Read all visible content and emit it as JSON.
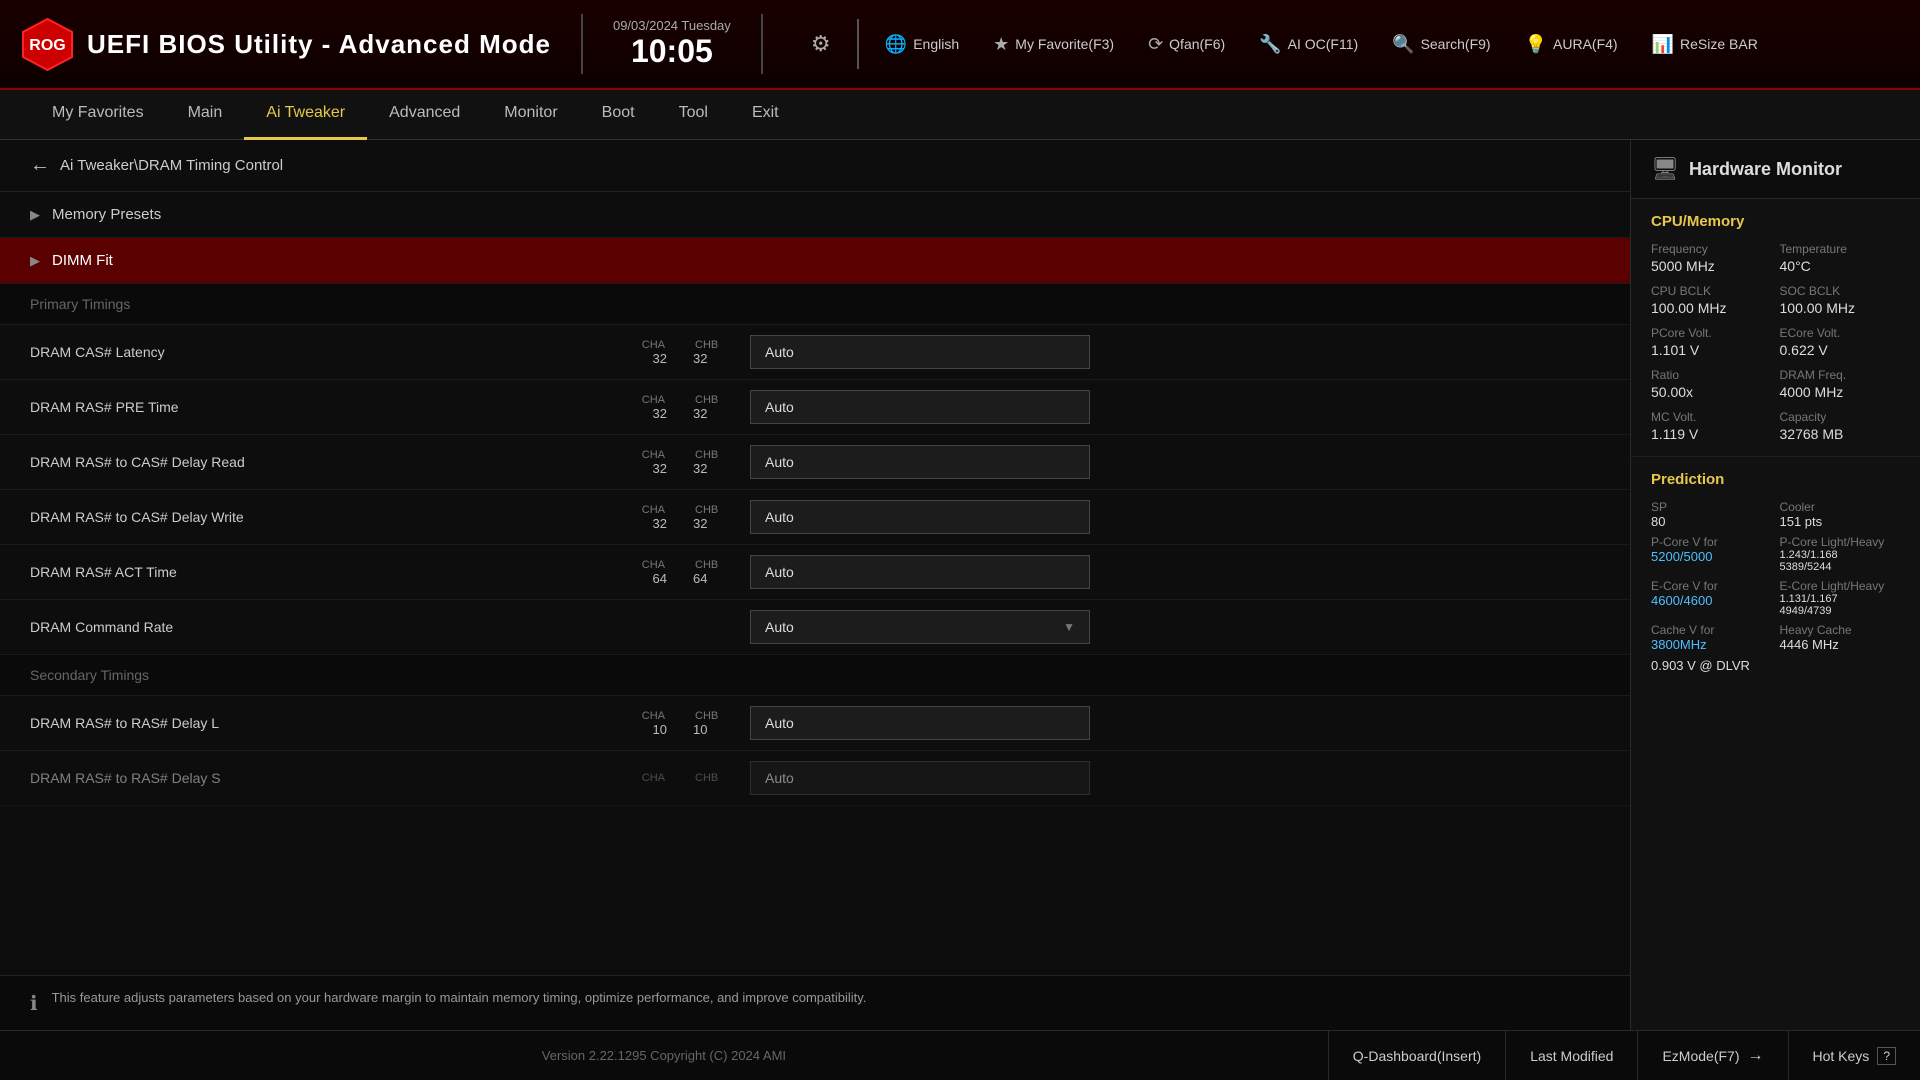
{
  "header": {
    "logo_alt": "ROG Logo",
    "title": "UEFI BIOS Utility - Advanced Mode",
    "date": "09/03/2024 Tuesday",
    "time": "10:05",
    "gear_icon": "⚙",
    "tools": [
      {
        "icon": "🌐",
        "label": "English",
        "key": ""
      },
      {
        "icon": "★",
        "label": "My Favorite(F3)",
        "key": "F3"
      },
      {
        "icon": "⟳",
        "label": "Qfan(F6)",
        "key": "F6"
      },
      {
        "icon": "🔧",
        "label": "AI OC(F11)",
        "key": "F11"
      },
      {
        "icon": "🔍",
        "label": "Search(F9)",
        "key": "F9"
      },
      {
        "icon": "💡",
        "label": "AURA(F4)",
        "key": "F4"
      },
      {
        "icon": "📊",
        "label": "ReSize BAR",
        "key": ""
      }
    ]
  },
  "nav": {
    "items": [
      {
        "label": "My Favorites",
        "active": false
      },
      {
        "label": "Main",
        "active": false
      },
      {
        "label": "Ai Tweaker",
        "active": true
      },
      {
        "label": "Advanced",
        "active": false
      },
      {
        "label": "Monitor",
        "active": false
      },
      {
        "label": "Boot",
        "active": false
      },
      {
        "label": "Tool",
        "active": false
      },
      {
        "label": "Exit",
        "active": false
      }
    ]
  },
  "breadcrumb": {
    "back_icon": "←",
    "path": "Ai Tweaker\\DRAM Timing Control"
  },
  "settings": {
    "sections": [
      {
        "type": "expandable",
        "label": "Memory Presets",
        "arrow": "▶",
        "highlighted": false
      },
      {
        "type": "expandable",
        "label": "DIMM Fit",
        "arrow": "▶",
        "highlighted": true
      }
    ],
    "primary_timings_header": "Primary Timings",
    "primary_timing_rows": [
      {
        "label": "DRAM CAS# Latency",
        "cha_label": "CHA",
        "chb_label": "CHB",
        "cha_val": "32",
        "chb_val": "32",
        "value": "Auto"
      },
      {
        "label": "DRAM RAS# PRE Time",
        "cha_label": "CHA",
        "chb_label": "CHB",
        "cha_val": "32",
        "chb_val": "32",
        "value": "Auto"
      },
      {
        "label": "DRAM RAS# to CAS# Delay Read",
        "cha_label": "CHA",
        "chb_label": "CHB",
        "cha_val": "32",
        "chb_val": "32",
        "value": "Auto"
      },
      {
        "label": "DRAM RAS# to CAS# Delay Write",
        "cha_label": "CHA",
        "chb_label": "CHB",
        "cha_val": "32",
        "chb_val": "32",
        "value": "Auto"
      },
      {
        "label": "DRAM RAS# ACT Time",
        "cha_label": "CHA",
        "chb_label": "CHB",
        "cha_val": "64",
        "chb_val": "64",
        "value": "Auto"
      },
      {
        "label": "DRAM Command Rate",
        "cha_label": "",
        "chb_label": "",
        "cha_val": "",
        "chb_val": "",
        "value": "Auto",
        "is_dropdown": true
      }
    ],
    "secondary_timings_header": "Secondary Timings",
    "secondary_timing_rows": [
      {
        "label": "DRAM RAS# to RAS# Delay L",
        "cha_label": "CHA",
        "chb_label": "CHB",
        "cha_val": "10",
        "chb_val": "10",
        "value": "Auto"
      },
      {
        "label": "DRAM RAS# to RAS# Delay S",
        "cha_label": "CHA",
        "chb_label": "CHB",
        "cha_val": "",
        "chb_val": "",
        "value": "Auto"
      }
    ],
    "info_text": "This feature adjusts parameters based on your hardware margin to maintain memory timing, optimize performance, and improve compatibility."
  },
  "hw_monitor": {
    "title": "Hardware Monitor",
    "monitor_icon": "🖥",
    "cpu_memory_section": {
      "title": "CPU/Memory",
      "items": [
        {
          "label": "Frequency",
          "value": "5000 MHz"
        },
        {
          "label": "Temperature",
          "value": "40°C"
        },
        {
          "label": "CPU BCLK",
          "value": "100.00 MHz"
        },
        {
          "label": "SOC BCLK",
          "value": "100.00 MHz"
        },
        {
          "label": "PCore Volt.",
          "value": "1.101 V"
        },
        {
          "label": "ECore Volt.",
          "value": "0.622 V"
        },
        {
          "label": "Ratio",
          "value": "50.00x"
        },
        {
          "label": "DRAM Freq.",
          "value": "4000 MHz"
        },
        {
          "label": "MC Volt.",
          "value": "1.119 V"
        },
        {
          "label": "Capacity",
          "value": "32768 MB"
        }
      ]
    },
    "prediction_section": {
      "title": "Prediction",
      "items": [
        {
          "label": "SP",
          "value": "80",
          "highlight": false
        },
        {
          "label": "Cooler",
          "value": "151 pts",
          "highlight": false
        },
        {
          "label": "P-Core V for",
          "value": "5200/5000",
          "highlight": true
        },
        {
          "label": "P-Core Light/Heavy",
          "value": "1.243/1.168 5389/5244",
          "highlight": false
        },
        {
          "label": "E-Core V for",
          "value": "4600/4600",
          "highlight": true
        },
        {
          "label": "E-Core Light/Heavy",
          "value": "1.131/1.167 4949/4739",
          "highlight": false
        },
        {
          "label": "Cache V for",
          "value": "3800MHz",
          "highlight": true
        },
        {
          "label": "Heavy Cache",
          "value": "4446 MHz",
          "highlight": false
        },
        {
          "label": "0.903 V @ DLVR",
          "value": "",
          "highlight": false
        }
      ]
    }
  },
  "footer": {
    "version": "Version 2.22.1295 Copyright (C) 2024 AMI",
    "buttons": [
      {
        "label": "Q-Dashboard(Insert)",
        "key": "Insert"
      },
      {
        "label": "Last Modified",
        "key": ""
      },
      {
        "label": "EzMode(F7)",
        "key": "F7",
        "has_arrow": true
      },
      {
        "label": "Hot Keys",
        "key": "?"
      }
    ]
  }
}
